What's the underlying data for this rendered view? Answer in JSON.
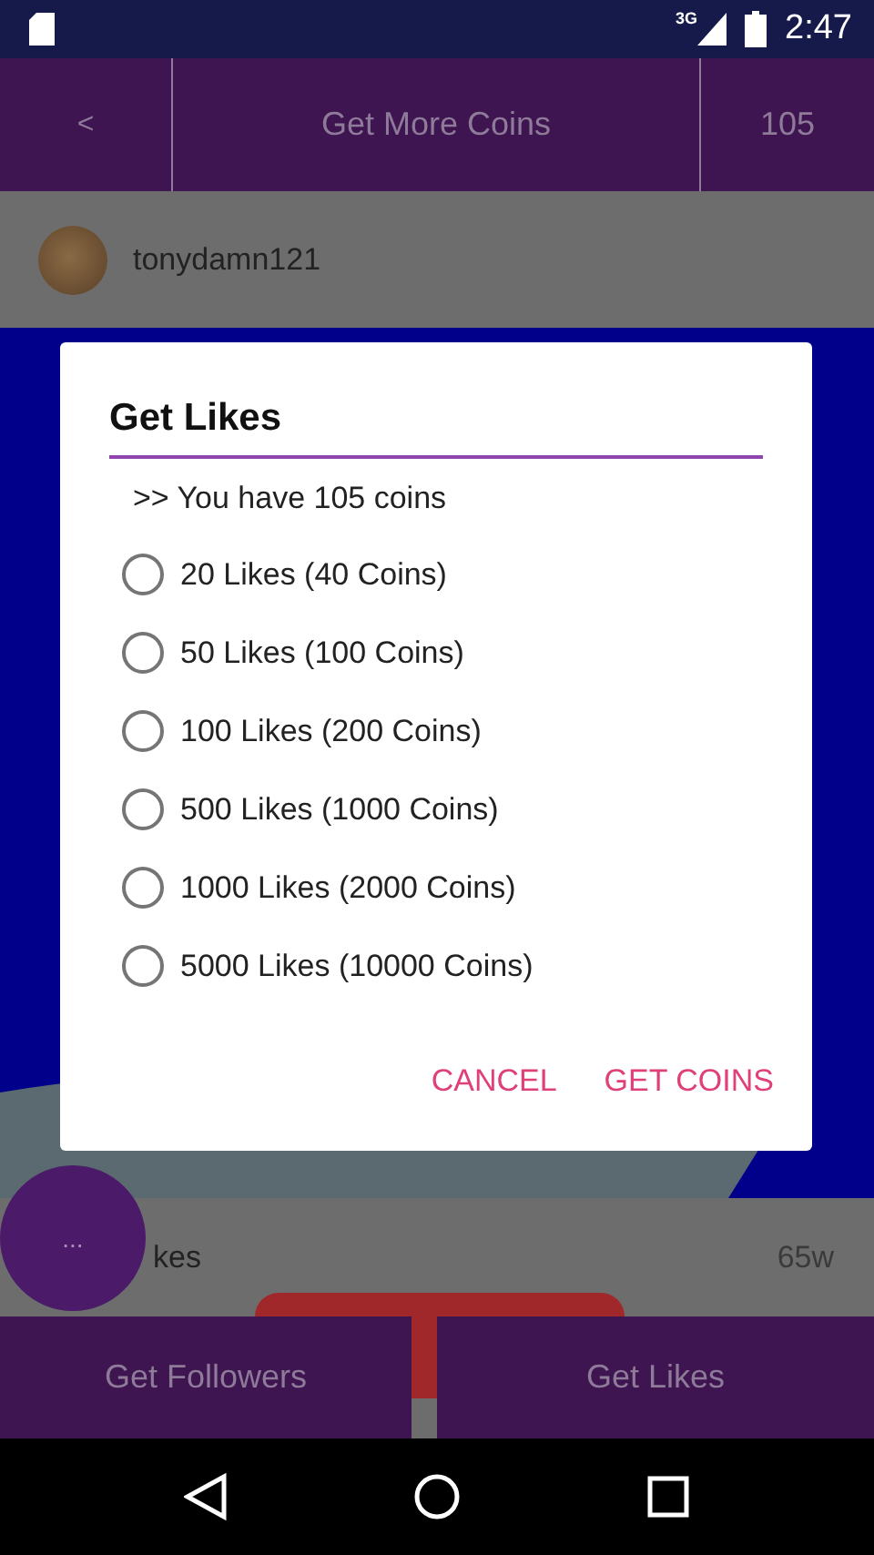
{
  "status_bar": {
    "time": "2:47",
    "network": "3G"
  },
  "app_bar": {
    "back": "<",
    "title": "Get More Coins",
    "coins": "105"
  },
  "profile": {
    "username": "tonydamn121"
  },
  "post": {
    "likes_text": "kes",
    "age": "65w"
  },
  "bottom_tabs": [
    {
      "label": "Get Followers"
    },
    {
      "label": "Get Likes"
    }
  ],
  "fab": {
    "label": "..."
  },
  "dialog": {
    "title": "Get Likes",
    "subtitle": ">> You have 105 coins",
    "options": [
      {
        "label": "20 Likes (40 Coins)",
        "selected": false
      },
      {
        "label": "50 Likes (100 Coins)",
        "selected": false
      },
      {
        "label": "100 Likes (200 Coins)",
        "selected": false
      },
      {
        "label": "500 Likes (1000 Coins)",
        "selected": false
      },
      {
        "label": "1000 Likes (2000 Coins)",
        "selected": false
      },
      {
        "label": "5000 Likes (10000 Coins)",
        "selected": false
      }
    ],
    "buttons": [
      "CANCEL",
      "GET COINS"
    ]
  }
}
